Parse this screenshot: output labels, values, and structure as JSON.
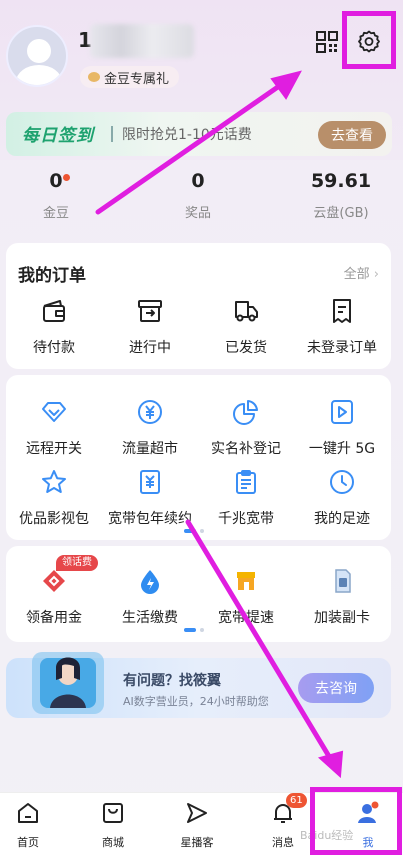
{
  "profile": {
    "username_visible": "1",
    "bean_tag": "金豆专属礼"
  },
  "checkin": {
    "badge": "每日签到",
    "promo": "限时抢兑1-10元话费",
    "button": "去查看"
  },
  "stats": [
    {
      "value": "0",
      "label": "金豆",
      "has_dot": true
    },
    {
      "value": "0",
      "label": "奖品"
    },
    {
      "value": "59.61",
      "label": "云盘(GB)"
    }
  ],
  "orders": {
    "title": "我的订单",
    "all_label": "全部",
    "items": [
      {
        "label": "待付款",
        "icon": "wallet-icon"
      },
      {
        "label": "进行中",
        "icon": "box-icon"
      },
      {
        "label": "已发货",
        "icon": "truck-icon"
      },
      {
        "label": "未登录订单",
        "icon": "doc-icon"
      }
    ]
  },
  "services": {
    "row1": [
      {
        "label": "远程开关",
        "icon": "diamond-icon"
      },
      {
        "label": "流量超市",
        "icon": "yen-circle-icon"
      },
      {
        "label": "实名补登记",
        "icon": "pie-icon"
      },
      {
        "label": "一键升 5G",
        "icon": "play-icon"
      }
    ],
    "row2": [
      {
        "label": "优品影视包",
        "icon": "star-icon"
      },
      {
        "label": "宽带包年续约",
        "icon": "yen-doc-icon"
      },
      {
        "label": "千兆宽带",
        "icon": "clipboard-icon"
      },
      {
        "label": "我的足迹",
        "icon": "clock-icon"
      }
    ]
  },
  "services2": {
    "items": [
      {
        "label": "领备用金",
        "icon": "diamond-red-icon",
        "tag": "领话费"
      },
      {
        "label": "生活缴费",
        "icon": "drop-icon"
      },
      {
        "label": "宽带提速",
        "icon": "shop-icon"
      },
      {
        "label": "加装副卡",
        "icon": "sim-icon"
      }
    ]
  },
  "banner": {
    "title": "有问题？找筱翼",
    "subtitle": "AI数字营业员，24小时帮助您",
    "button": "去咨询"
  },
  "tabbar": {
    "items": [
      {
        "label": "首页",
        "icon": "home-icon"
      },
      {
        "label": "商城",
        "icon": "bag-icon"
      },
      {
        "label": "星播客",
        "icon": "send-icon"
      },
      {
        "label": "消息",
        "icon": "bell-icon",
        "badge": "61"
      },
      {
        "label": "我",
        "icon": "person-icon",
        "active": true
      }
    ]
  },
  "watermark": "Baidu经验",
  "colors": {
    "accent": "#3a8ef5",
    "highlight": "#e01ee0",
    "checkin_green": "#1ea26f",
    "badge_red": "#e53333"
  }
}
